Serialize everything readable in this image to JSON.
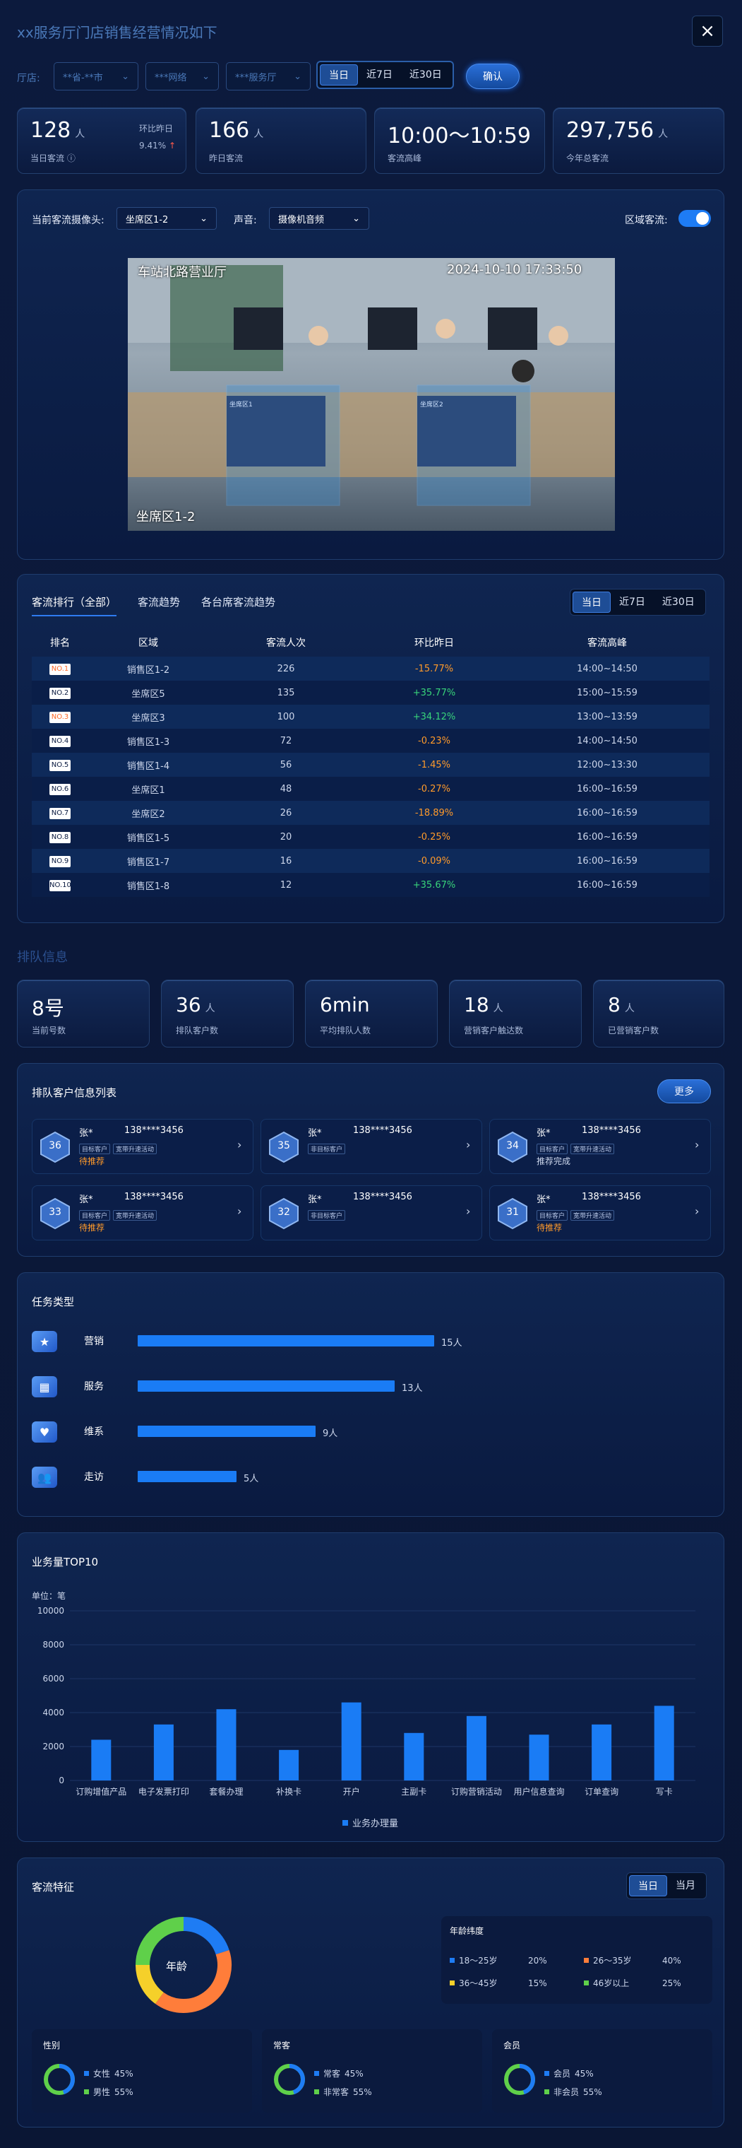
{
  "header": {
    "title": "xx服务厅门店销售经营情况如下",
    "close": "×"
  },
  "filters": {
    "label": "厅店:",
    "city": "**省-**市",
    "network": "***网络",
    "hall": "***服务厅",
    "periods": [
      "当日",
      "近7日",
      "近30日"
    ],
    "confirm": "确认"
  },
  "stats": [
    {
      "value": "128",
      "unit": "人",
      "label": "当日客流",
      "extra_label": "环比昨日",
      "extra_value": "9.41%",
      "extra_arrow": "↑"
    },
    {
      "value": "166",
      "unit": "人",
      "label": "昨日客流"
    },
    {
      "value": "10:00～10:59",
      "unit": "",
      "label": "客流高峰"
    },
    {
      "value": "297,756",
      "unit": "人",
      "label": "今年总客流"
    }
  ],
  "camera": {
    "cam_label": "当前客流摄像头:",
    "cam_value": "坐席区1-2",
    "audio_label": "声音:",
    "audio_value": "摄像机音频",
    "region_label": "区域客流:",
    "overlay_hall": "车站北路营业厅",
    "overlay_time": "2024-10-10 17:33:50",
    "overlay_zone": "坐席区1-2",
    "box_left": "坐席区1",
    "box_right": "坐席区2"
  },
  "ranking": {
    "tabs": [
      "客流排行（全部）",
      "客流趋势",
      "各台席客流趋势"
    ],
    "periods": [
      "当日",
      "近7日",
      "近30日"
    ],
    "headers": [
      "排名",
      "区域",
      "客流人次",
      "环比昨日",
      "客流高峰"
    ],
    "rows": [
      {
        "rank": "NO.1",
        "area": "销售区1-2",
        "count": "226",
        "change": "-15.77%",
        "dir": "down",
        "peak": "14:00~14:50"
      },
      {
        "rank": "NO.2",
        "area": "坐席区5",
        "count": "135",
        "change": "+35.77%",
        "dir": "up",
        "peak": "15:00~15:59"
      },
      {
        "rank": "NO.3",
        "area": "坐席区3",
        "count": "100",
        "change": "+34.12%",
        "dir": "up",
        "peak": "13:00~13:59"
      },
      {
        "rank": "NO.4",
        "area": "销售区1-3",
        "count": "72",
        "change": "-0.23%",
        "dir": "down",
        "peak": "14:00~14:50"
      },
      {
        "rank": "NO.5",
        "area": "销售区1-4",
        "count": "56",
        "change": "-1.45%",
        "dir": "down",
        "peak": "12:00~13:30"
      },
      {
        "rank": "NO.6",
        "area": "坐席区1",
        "count": "48",
        "change": "-0.27%",
        "dir": "down",
        "peak": "16:00~16:59"
      },
      {
        "rank": "NO.7",
        "area": "坐席区2",
        "count": "26",
        "change": "-18.89%",
        "dir": "down",
        "peak": "16:00~16:59"
      },
      {
        "rank": "NO.8",
        "area": "销售区1-5",
        "count": "20",
        "change": "-0.25%",
        "dir": "down",
        "peak": "16:00~16:59"
      },
      {
        "rank": "NO.9",
        "area": "销售区1-7",
        "count": "16",
        "change": "-0.09%",
        "dir": "down",
        "peak": "16:00~16:59"
      },
      {
        "rank": "NO.10",
        "area": "销售区1-8",
        "count": "12",
        "change": "+35.67%",
        "dir": "up",
        "peak": "16:00~16:59"
      }
    ]
  },
  "queue": {
    "section_title": "排队信息",
    "stats": [
      {
        "value": "8号",
        "unit": "",
        "label": "当前号数"
      },
      {
        "value": "36",
        "unit": "人",
        "label": "排队客户数"
      },
      {
        "value": "6min",
        "unit": "",
        "label": "平均排队人数"
      },
      {
        "value": "18",
        "unit": "人",
        "label": "营销客户触达数"
      },
      {
        "value": "8",
        "unit": "人",
        "label": "已营销客户数"
      }
    ],
    "list_title": "排队客户信息列表",
    "more": "更多",
    "customers": [
      {
        "num": "36",
        "name": "张*",
        "phone": "138****3456",
        "tags": [
          "目标客户",
          "宽带升速活动"
        ],
        "status": "待推荐",
        "status_color": "#ff9a2a"
      },
      {
        "num": "35",
        "name": "张*",
        "phone": "138****3456",
        "tags": [
          "非目标客户"
        ],
        "status": "",
        "status_color": "#ff9a2a"
      },
      {
        "num": "34",
        "name": "张*",
        "phone": "138****3456",
        "tags": [
          "目标客户",
          "宽带升速活动"
        ],
        "status": "推荐完成",
        "status_color": "#cdd7ec"
      },
      {
        "num": "33",
        "name": "张*",
        "phone": "138****3456",
        "tags": [
          "目标客户",
          "宽带升速活动"
        ],
        "status": "待推荐",
        "status_color": "#ff9a2a"
      },
      {
        "num": "32",
        "name": "张*",
        "phone": "138****3456",
        "tags": [
          "非目标客户"
        ],
        "status": "",
        "status_color": "#ff9a2a"
      },
      {
        "num": "31",
        "name": "张*",
        "phone": "138****3456",
        "tags": [
          "目标客户",
          "宽带升速活动"
        ],
        "status": "待推荐",
        "status_color": "#ff9a2a"
      }
    ]
  },
  "tasks": {
    "title": "任务类型",
    "items": [
      {
        "label": "营销",
        "count": "15人",
        "value": 15,
        "icon": "folder-star-icon"
      },
      {
        "label": "服务",
        "count": "13人",
        "value": 13,
        "icon": "grid-blocks-icon"
      },
      {
        "label": "维系",
        "count": "9人",
        "value": 9,
        "icon": "heart-icon"
      },
      {
        "label": "走访",
        "count": "5人",
        "value": 5,
        "icon": "people-icon"
      }
    ]
  },
  "chart_data": {
    "type": "bar",
    "title": "业务量TOP10",
    "unit_label": "单位：笔",
    "categories": [
      "订购增值产品",
      "电子发票打印",
      "套餐办理",
      "补换卡",
      "开户",
      "主副卡",
      "订购营销活动",
      "用户信息查询",
      "订单查询",
      "写卡"
    ],
    "series": [
      {
        "name": "业务办理量",
        "values": [
          2400,
          3300,
          4200,
          1800,
          4600,
          2800,
          3800,
          2700,
          3300,
          4400
        ]
      }
    ],
    "ylim": [
      0,
      10000
    ],
    "yticks": [
      0,
      2000,
      4000,
      6000,
      8000,
      10000
    ],
    "legend": "bottom-center",
    "color": "#1a7cf5"
  },
  "features": {
    "title": "客流特征",
    "periods": [
      "当日",
      "当月"
    ],
    "donut_label": "年龄",
    "age_title": "年龄纬度",
    "age": [
      {
        "label": "18～25岁",
        "pct": "20%",
        "color": "#1e7cf4",
        "value": 20
      },
      {
        "label": "26～35岁",
        "pct": "40%",
        "color": "#ff7d3a",
        "value": 40
      },
      {
        "label": "36～45岁",
        "pct": "15%",
        "color": "#f5d02a",
        "value": 15
      },
      {
        "label": "46岁以上",
        "pct": "25%",
        "color": "#5fd04a",
        "value": 25
      }
    ],
    "groups": [
      {
        "title": "性别",
        "items": [
          {
            "label": "女性",
            "pct": "45%"
          },
          {
            "label": "男性",
            "pct": "55%"
          }
        ]
      },
      {
        "title": "常客",
        "items": [
          {
            "label": "常客",
            "pct": "45%"
          },
          {
            "label": "非常客",
            "pct": "55%"
          }
        ]
      },
      {
        "title": "会员",
        "items": [
          {
            "label": "会员",
            "pct": "45%"
          },
          {
            "label": "非会员",
            "pct": "55%"
          }
        ]
      }
    ]
  }
}
